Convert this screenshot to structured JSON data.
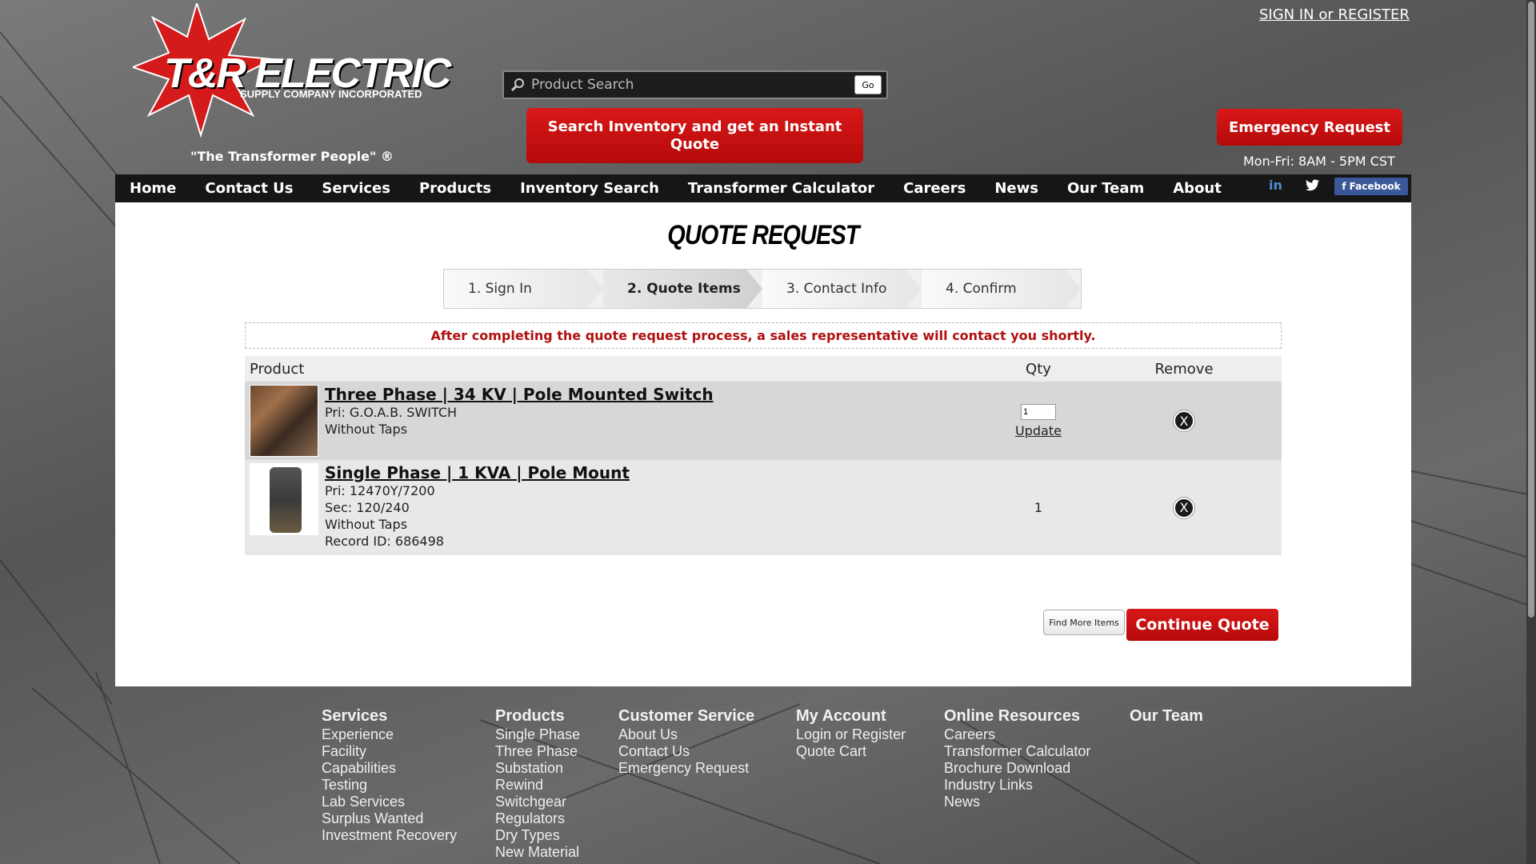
{
  "header": {
    "sign_in": "SIGN IN or REGISTER",
    "logo_main": "T&R ELECTRIC",
    "logo_sub": "SUPPLY COMPANY INCORPORATED",
    "tagline": "\"The Transformer People\" ®",
    "search_placeholder": "Product Search",
    "search_go": "Go",
    "instant_quote": "Search Inventory and get an Instant Quote",
    "emergency": "Emergency Request",
    "hours": "Mon-Fri: 8AM - 5PM CST"
  },
  "nav": {
    "items": [
      "Home",
      "Contact Us",
      "Services",
      "Products",
      "Inventory Search",
      "Transformer Calculator",
      "Careers",
      "News",
      "Our Team",
      "About"
    ],
    "linkedin": "in",
    "twitter_icon": "twitter-icon",
    "facebook": "Facebook"
  },
  "main": {
    "title": "QUOTE REQUEST",
    "steps": [
      "1. Sign In",
      "2. Quote Items",
      "3. Contact Info",
      "4. Confirm"
    ],
    "active_step": 1,
    "notice": "After completing the quote request process, a sales representative will contact you shortly.",
    "table_headers": {
      "product": "Product",
      "qty": "Qty",
      "remove": "Remove"
    },
    "items": [
      {
        "title": "Three Phase | 34 KV | Pole Mounted Switch",
        "lines": [
          "Pri: G.O.A.B. SWITCH",
          "Without Taps"
        ],
        "qty_value": "1",
        "update_label": "Update",
        "remove_label": "X"
      },
      {
        "title": "Single Phase | 1 KVA | Pole Mount",
        "lines": [
          "Pri: 12470Y/7200",
          "Sec: 120/240",
          "Without Taps",
          "Record ID: 686498"
        ],
        "qty": "1",
        "remove_label": "X"
      }
    ],
    "find_more": "Find More Items",
    "continue": "Continue Quote"
  },
  "footer": {
    "columns": [
      {
        "heading": "Services",
        "links": [
          "Experience",
          "Facility",
          "Capabilities",
          "Testing",
          "Lab Services",
          "Surplus Wanted",
          "Investment Recovery"
        ]
      },
      {
        "heading": "Products",
        "links": [
          "Single Phase",
          "Three Phase",
          "Substation",
          "Rewind",
          "Switchgear",
          "Regulators",
          "Dry Types",
          "New Material"
        ]
      },
      {
        "heading": "Customer Service",
        "links": [
          "About Us",
          "Contact Us",
          "Emergency Request"
        ]
      },
      {
        "heading": "My Account",
        "links": [
          "Login or Register",
          "Quote Cart"
        ]
      },
      {
        "heading": "Online Resources",
        "links": [
          "Careers",
          "Transformer Calculator",
          "Brochure Download",
          "Industry Links",
          "News"
        ]
      },
      {
        "heading": "Our Team",
        "links": []
      }
    ]
  },
  "colors": {
    "brand_red": "#c81010",
    "nav_bg": "#161616",
    "notice_red": "#b01010"
  }
}
